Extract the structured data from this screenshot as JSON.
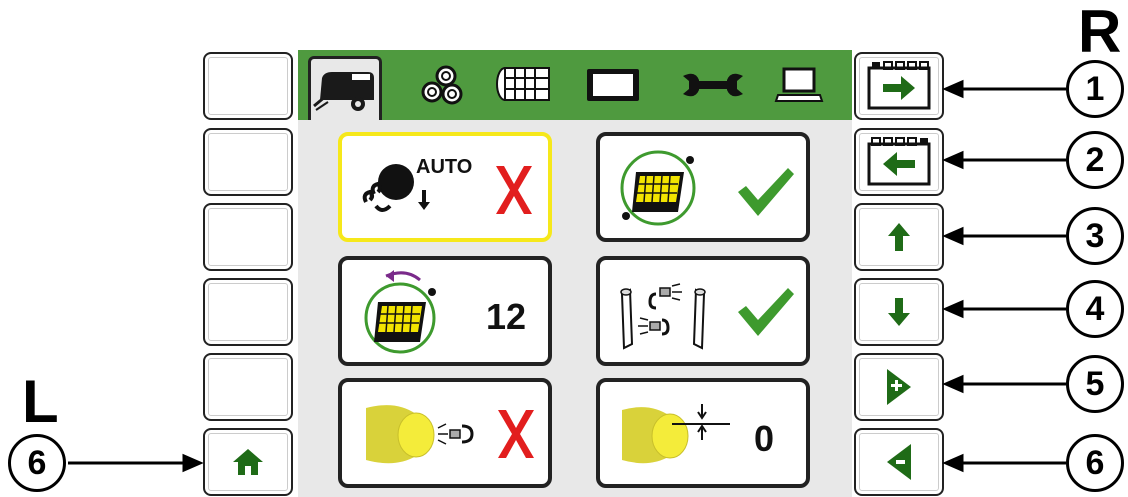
{
  "side_labels": {
    "right": "R",
    "left": "L"
  },
  "tabs": [
    {
      "icon": "baler-icon",
      "active": true
    },
    {
      "icon": "bales-icon",
      "active": false
    },
    {
      "icon": "net-roll-icon",
      "active": false
    },
    {
      "icon": "display-icon",
      "active": false
    },
    {
      "icon": "wrench-icon",
      "active": false
    },
    {
      "icon": "laptop-icon",
      "active": false
    }
  ],
  "left_keys": [
    {
      "icon": ""
    },
    {
      "icon": ""
    },
    {
      "icon": ""
    },
    {
      "icon": ""
    },
    {
      "icon": ""
    },
    {
      "icon": "home-icon"
    }
  ],
  "right_keys": [
    {
      "icon": "next-page-icon",
      "callout": "1"
    },
    {
      "icon": "previous-page-icon",
      "callout": "2"
    },
    {
      "icon": "arrow-up-icon",
      "callout": "3"
    },
    {
      "icon": "arrow-down-icon",
      "callout": "4"
    },
    {
      "icon": "increase-icon",
      "callout": "5"
    },
    {
      "icon": "decrease-icon",
      "callout": "6"
    }
  ],
  "left_callout": "6",
  "tiles": [
    {
      "name": "auto-bale-eject",
      "caption": "AUTO",
      "value": "",
      "status": "disabled",
      "selected": true
    },
    {
      "name": "pickup-monitoring",
      "value": "",
      "status": "enabled",
      "selected": false
    },
    {
      "name": "pickup-speed",
      "value": "12",
      "status": "",
      "selected": false
    },
    {
      "name": "sensors-check",
      "value": "",
      "status": "enabled",
      "selected": false
    },
    {
      "name": "bale-sensor",
      "value": "",
      "status": "disabled",
      "selected": false
    },
    {
      "name": "bale-diameter-adjust",
      "value": "0",
      "status": "",
      "selected": false
    }
  ],
  "colors": {
    "accent": "#4f9a3f",
    "check": "#3e9a2e",
    "cross": "#e21e1e",
    "selection": "#f6e81a",
    "key_icon": "#1f6b17"
  }
}
